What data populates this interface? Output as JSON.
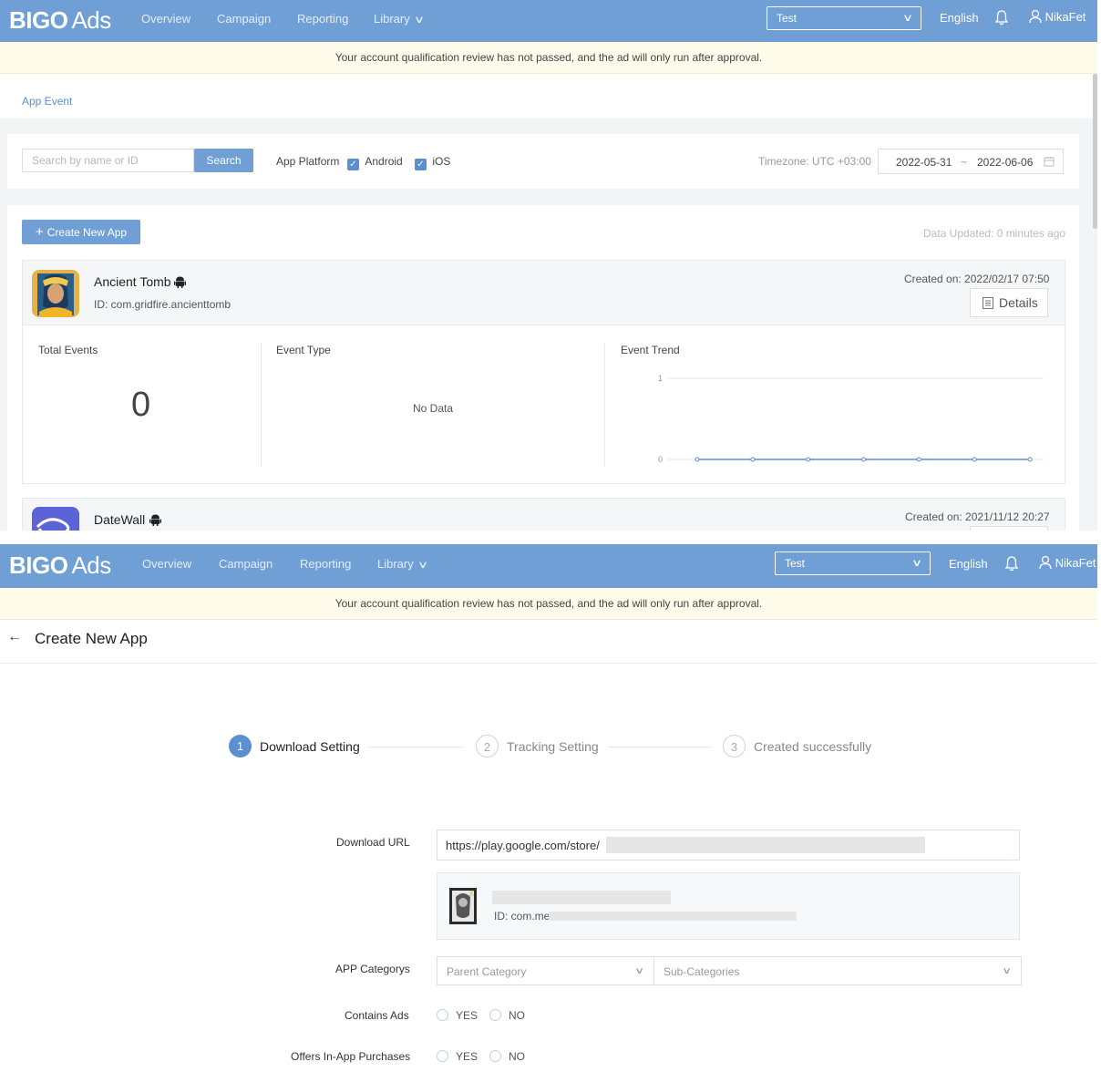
{
  "header": {
    "logo_bold": "BIGO",
    "logo_light": "Ads",
    "nav": [
      "Overview",
      "Campaign",
      "Reporting",
      "Library"
    ],
    "account": "Test",
    "language": "English",
    "user": "NikaFet"
  },
  "banner": "Your account qualification review has not passed, and the ad will only run after approval.",
  "list_page": {
    "breadcrumb": "App Event",
    "search_placeholder": "Search by name or ID",
    "search_button": "Search",
    "platform_label": "App Platform",
    "platforms": [
      {
        "label": "Android",
        "checked": true
      },
      {
        "label": "iOS",
        "checked": true
      }
    ],
    "timezone": "Timezone: UTC +03:00",
    "date_start": "2022-05-31",
    "date_sep": "~",
    "date_end": "2022-06-06",
    "create_button": "Create New App",
    "data_updated": "Data Updated: 0 minutes ago",
    "apps": [
      {
        "name": "Ancient Tomb",
        "id": "ID: com.gridfire.ancienttomb",
        "created": "Created on: 2022/02/17 07:50",
        "details": "Details",
        "total_events_label": "Total Events",
        "total_events": "0",
        "event_type_label": "Event Type",
        "event_type_value": "No Data",
        "event_trend_label": "Event Trend"
      },
      {
        "name": "DateWall",
        "created": "Created on: 2021/11/12 20:27"
      }
    ]
  },
  "chart_data": {
    "type": "line",
    "x": [
      1,
      2,
      3,
      4,
      5,
      6,
      7
    ],
    "series": [
      {
        "values": [
          0,
          0,
          0,
          0,
          0,
          0,
          0
        ]
      }
    ],
    "yticks": [
      "1",
      "0"
    ],
    "ylim": [
      0,
      1
    ],
    "grid": true,
    "color": "#5b8fd0"
  },
  "create_page": {
    "back_icon": "arrow-left-icon",
    "title": "Create New App",
    "steps": [
      {
        "num": "1",
        "label": "Download Setting",
        "active": true
      },
      {
        "num": "2",
        "label": "Tracking Setting",
        "active": false
      },
      {
        "num": "3",
        "label": "Created successfully",
        "active": false
      }
    ],
    "download_url_label": "Download URL",
    "download_url_value": "https://play.google.com/store/",
    "app_preview_id": "ID: com.me",
    "categories_label": "APP Categorys",
    "parent_category_placeholder": "Parent Category",
    "sub_category_placeholder": "Sub-Categories",
    "contains_ads_label": "Contains Ads",
    "offers_iap_label": "Offers In-App Purchases",
    "yes": "YES",
    "no": "NO"
  },
  "colors": {
    "header": "#6f9fd4",
    "accent": "#5b8fd0",
    "banner": "#fffbea"
  }
}
